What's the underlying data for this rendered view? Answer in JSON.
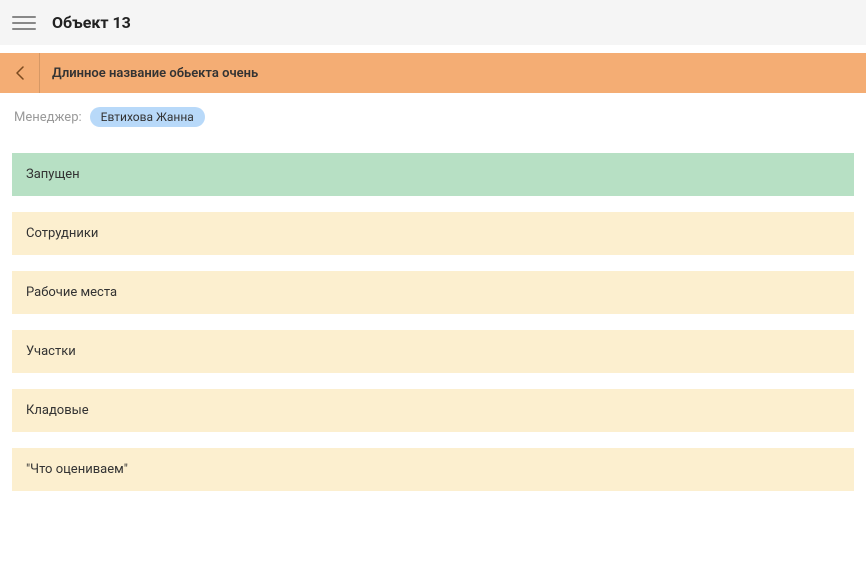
{
  "header": {
    "title": "Объект 13"
  },
  "subheader": {
    "title": "Длинное название обьекта очень"
  },
  "meta": {
    "manager_label": "Менеджер:",
    "manager_name": "Евтихова Жанна"
  },
  "sections": [
    {
      "label": "Запущен",
      "variant": "green"
    },
    {
      "label": "Сотрудники",
      "variant": "cream"
    },
    {
      "label": "Рабочие места",
      "variant": "cream"
    },
    {
      "label": "Участки",
      "variant": "cream"
    },
    {
      "label": "Кладовые",
      "variant": "cream"
    },
    {
      "label": "\"Что оцениваем\"",
      "variant": "cream"
    }
  ]
}
